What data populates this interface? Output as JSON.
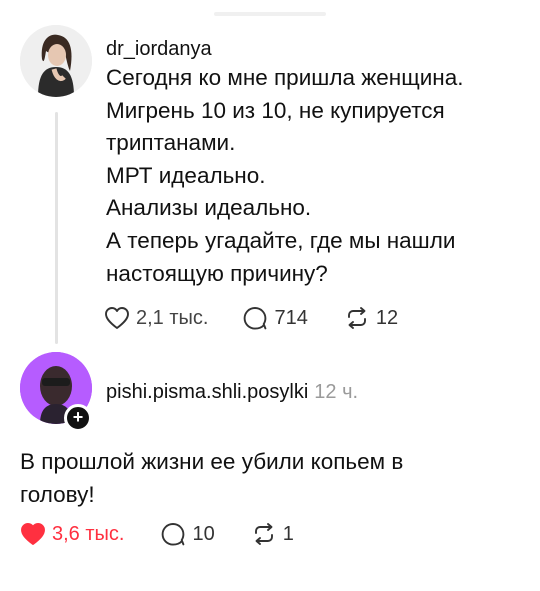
{
  "posts": [
    {
      "username": "dr_iordanya",
      "lines": [
        "Сегодня ко мне пришла женщина.",
        "Мигрень 10 из 10, не купируется",
        "триптанами.",
        "МРТ идеально.",
        "Анализы идеально.",
        "А теперь угадайте, где мы нашли",
        "настоящую причину?"
      ],
      "likes": "2,1 тыс.",
      "comments": "714",
      "reposts": "12",
      "like_state": "not-liked"
    },
    {
      "username": "pishi.pisma.shli.posylki",
      "time": "12 ч.",
      "lines": [
        "В прошлой жизни ее убили копьем в",
        "голову!"
      ],
      "likes": "3,6 тыс.",
      "comments": "10",
      "reposts": "1",
      "like_state": "liked"
    }
  ],
  "follow_badge": "+",
  "colors": {
    "liked": "#ff3040",
    "icon": "#333333",
    "timestamp": "#9a9a9a",
    "avatar2_bg": "#b65cff"
  }
}
